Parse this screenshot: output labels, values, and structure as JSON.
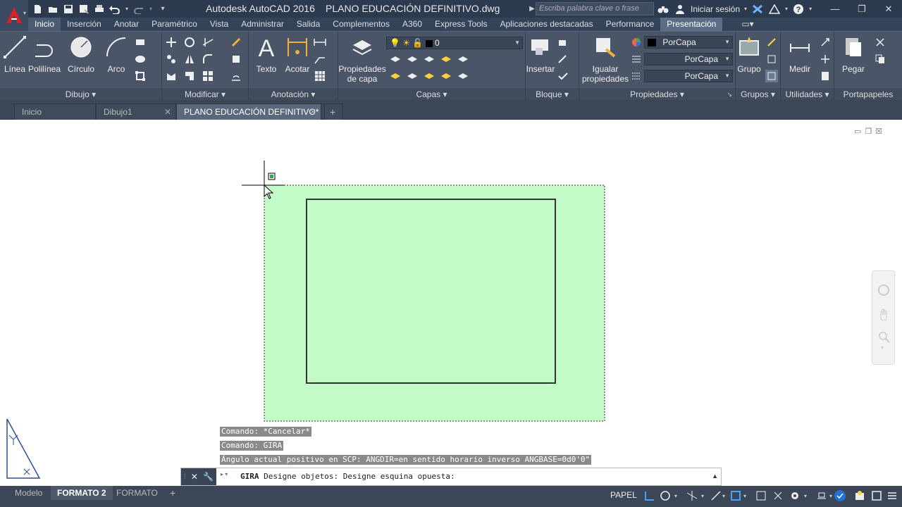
{
  "titlebar": {
    "app_title": "Autodesk AutoCAD 2016",
    "document": "PLANO EDUCACIÓN DEFINITIVO.dwg",
    "search_placeholder": "Escriba palabra clave o frase",
    "login_label": "Iniciar sesión"
  },
  "ribbon_tabs": [
    "Inicio",
    "Inserción",
    "Anotar",
    "Paramétrico",
    "Vista",
    "Administrar",
    "Salida",
    "Complementos",
    "A360",
    "Express Tools",
    "Aplicaciones destacadas",
    "Performance",
    "Presentación"
  ],
  "panels": {
    "dibujo": {
      "title": "Dibujo ▾",
      "linea": "Línea",
      "polilinea": "Polilínea",
      "circulo": "Círculo",
      "arco": "Arco"
    },
    "modificar": {
      "title": "Modificar ▾"
    },
    "anotacion": {
      "title": "Anotación ▾",
      "texto": "Texto",
      "acotar": "Acotar"
    },
    "capas": {
      "title": "Capas ▾",
      "propiedades_line1": "Propiedades",
      "propiedades_line2": "de capa",
      "current_layer": "0"
    },
    "bloque": {
      "title": "Bloque ▾",
      "insertar": "Insertar"
    },
    "propiedades": {
      "title": "Propiedades ▾",
      "igualar_line1": "Igualar",
      "igualar_line2": "propiedades",
      "color": "PorCapa",
      "linetype": "PorCapa",
      "lineweight": "PorCapa"
    },
    "grupos": {
      "title": "Grupos ▾",
      "grupo": "Grupo"
    },
    "utilidades": {
      "title": "Utilidades ▾",
      "medir": "Medir"
    },
    "portapapeles": {
      "title": "Portapapeles",
      "pegar": "Pegar"
    }
  },
  "file_tabs": [
    {
      "label": "Inicio"
    },
    {
      "label": "Dibujo1"
    },
    {
      "label": "PLANO EDUCACIÓN DEFINITIVO*"
    }
  ],
  "command_history": [
    "Comando: *Cancelar*",
    "Comando: GIRA",
    "Ángulo actual positivo en SCP:  ANGDIR=en sentido horario inverso ANGBASE=0d0'0\""
  ],
  "command_line": {
    "cmd": "GIRA",
    "prompt": "Designe objetos: Designe esquina opuesta:"
  },
  "layout_tabs": [
    "Modelo",
    "FORMATO 2",
    "FORMATO"
  ],
  "status": {
    "space": "PAPEL"
  },
  "colors": {
    "selection_fill": "#c2fbc8",
    "titlebar": "#2b3a4e",
    "ribbon": "#4a5668",
    "accent": "#1e73d8"
  }
}
